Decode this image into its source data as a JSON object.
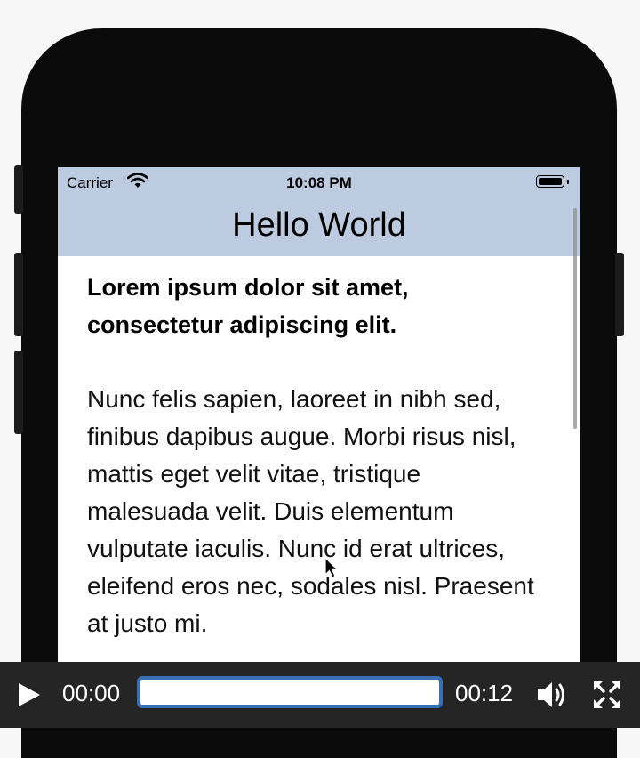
{
  "status_bar": {
    "carrier": "Carrier",
    "time": "10:08 PM"
  },
  "nav_bar": {
    "title": "Hello World"
  },
  "content": {
    "heading": "Lorem ipsum dolor sit amet, consectetur adipiscing elit.",
    "body": "Nunc felis sapien, laoreet in nibh sed, finibus dapibus augue. Morbi risus nisl, mattis eget velit vitae, tristique malesuada velit. Duis elementum vulputate iaculis. Nunc id erat ultrices, eleifend eros nec, sodales nisl. Praesent at justo mi."
  },
  "player": {
    "current_time": "00:00",
    "total_time": "00:12",
    "progress": 0.0
  },
  "icons": [
    "wifi-icon",
    "battery-icon",
    "play-icon",
    "volume-icon",
    "fullscreen-icon",
    "mouse-cursor-icon"
  ],
  "colors": {
    "nav_background": "#bccbe0",
    "phone_frame": "#0b0b0b",
    "player_background": "#252525",
    "progress_border": "#3b6fb5"
  }
}
